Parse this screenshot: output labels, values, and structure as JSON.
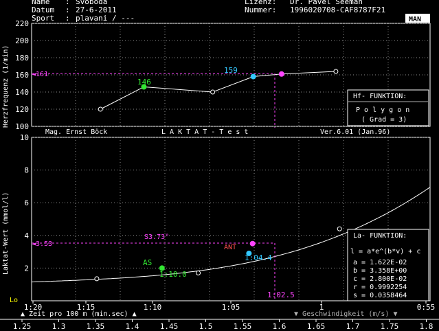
{
  "header": {
    "name_label": "Name",
    "name_value": "Svoboda",
    "datum_label": "Datum",
    "datum_value": "27-6-2011",
    "sport_label": "Sport",
    "sport_value": "plavani / ---",
    "licence_label": "Lizenz:",
    "licence_value": "Dr. Pavel Seeman",
    "number_label": "Nummer:",
    "number_value": "1996020708-CAF8787F21",
    "mode_badge": "MAN"
  },
  "mid_banner": {
    "author": "Mag. Ernst Böck",
    "title": "L A K T A T  -  T e s t",
    "version": "Ver.6.01 (Jan.96)"
  },
  "hf_panel": {
    "title": "Hf- FUNKTION:",
    "type": "P o l y g o n",
    "grade": "( Grad = 3)"
  },
  "la_panel": {
    "title": "La- FUNKTION:",
    "formula": "l = a*e^(b*v) + c",
    "a": "a = 1.622E-02",
    "b": "b = 3.358E+00",
    "c": "c = 2.800E-02",
    "r": "r = 0.9992254",
    "s": "s = 0.0358464"
  },
  "hf_axis_label": "Herzfrequenz (1/min)",
  "la_axis_label": "Laktat-Wert (mmol/l)",
  "bottom": {
    "left_label": "Zeit pro 100 m (min.sec)",
    "right_label": "Geschwindigkeit (m/s)",
    "lo_label": "Lo",
    "time_ticks": [
      "1:20",
      "1:15",
      "1:10",
      "1:05",
      "1",
      "0:55"
    ],
    "speed_ticks": [
      "1.25",
      "1.3",
      "1.35",
      "1.4",
      "1.45",
      "1.5",
      "1.55",
      "1.6",
      "1.65",
      "1.7",
      "1.75",
      "1.8"
    ]
  },
  "annotations": {
    "hf_ref": "161",
    "hf_as": "146",
    "hf_ant": "159",
    "la_ref": "3.53",
    "la_at": "3.73°",
    "la_ant": "ANT",
    "la_as": "AS",
    "la_as_time": "1:10.0",
    "la_ant_time": "1:04.4",
    "vert_time": "1:02.5"
  },
  "colors": {
    "background": "#000000",
    "axis": "#ffffff",
    "grid": "#8c8c8c",
    "as_point": "#33e633",
    "ant_point": "#33c8ff",
    "marker": "#ff44ff",
    "ant_text": "#ff5050",
    "panel_border": "#ffffff",
    "hf_panel_header": "#b0b0b0"
  },
  "chart_data": [
    {
      "type": "line",
      "title": "",
      "xlabel": "Zeit pro 100 m (min.sec)",
      "ylabel": "Herzfrequenz (1/min)",
      "ylim": [
        100,
        220
      ],
      "x_unit": "m/s",
      "xlim": [
        1.25,
        1.8
      ],
      "yticks": [
        100,
        120,
        140,
        160,
        180,
        200,
        220
      ],
      "series": [
        {
          "x": [
            1.345,
            1.5,
            1.405,
            1.556,
            1.595,
            1.67
          ],
          "y": [
            120,
            140,
            146,
            158,
            161,
            164
          ]
        }
      ]
    },
    {
      "type": "line",
      "title": "",
      "xlabel": "Geschwindigkeit (m/s)",
      "ylabel": "Laktat-Wert (mmol/l)",
      "ylim": [
        0,
        10
      ],
      "xlim": [
        1.25,
        1.8
      ],
      "yticks": [
        2,
        4,
        6,
        8,
        10
      ],
      "series": [
        {
          "x": [
            1.34,
            1.48,
            1.43,
            1.55,
            1.555,
            1.675
          ],
          "y": [
            1.35,
            1.7,
            2.0,
            2.9,
            3.5,
            4.4
          ]
        }
      ]
    }
  ]
}
